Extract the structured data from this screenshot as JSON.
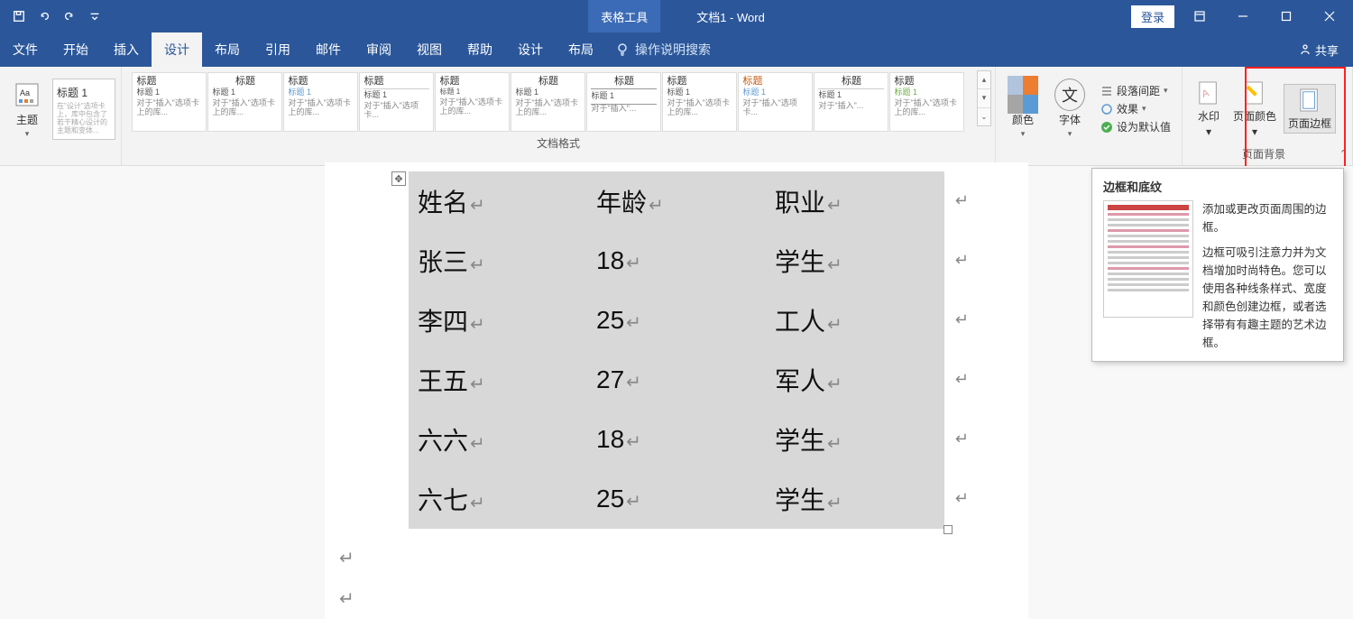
{
  "titlebar": {
    "context_tab": "表格工具",
    "doc_title": "文档1 - Word",
    "login": "登录"
  },
  "tabs": {
    "file": "文件",
    "home": "开始",
    "insert": "插入",
    "design": "设计",
    "layout": "布局",
    "references": "引用",
    "mailings": "邮件",
    "review": "审阅",
    "view": "视图",
    "help": "帮助",
    "tbl_design": "设计",
    "tbl_layout": "布局",
    "tell_me": "操作说明搜索",
    "share": "共享"
  },
  "ribbon": {
    "themes_label": "主题",
    "theme_card_heading": "标题 1",
    "docfmt_label": "文档格式",
    "title_word": "标题",
    "subtitle_word": "标题 1",
    "colors": "颜色",
    "fonts": "字体",
    "font_glyph": "文",
    "settings": {
      "para_spacing": "段落间距",
      "effects": "效果",
      "set_default": "设为默认值"
    },
    "pb": {
      "watermark": "水印",
      "page_color": "页面颜色",
      "page_borders": "页面边框",
      "group_label": "页面背景"
    }
  },
  "table": {
    "headers": [
      "姓名",
      "年龄",
      "职业"
    ],
    "rows": [
      [
        "张三",
        "18",
        "学生"
      ],
      [
        "李四",
        "25",
        "工人"
      ],
      [
        "王五",
        "27",
        "军人"
      ],
      [
        "六六",
        "18",
        "学生"
      ],
      [
        "六七",
        "25",
        "学生"
      ]
    ]
  },
  "tooltip": {
    "title": "边框和底纹",
    "line1": "添加或更改页面周围的边框。",
    "line2": "边框可吸引注意力并为文档增加时尚特色。您可以使用各种线条样式、宽度和颜色创建边框，或者选择带有有趣主题的艺术边框。"
  }
}
